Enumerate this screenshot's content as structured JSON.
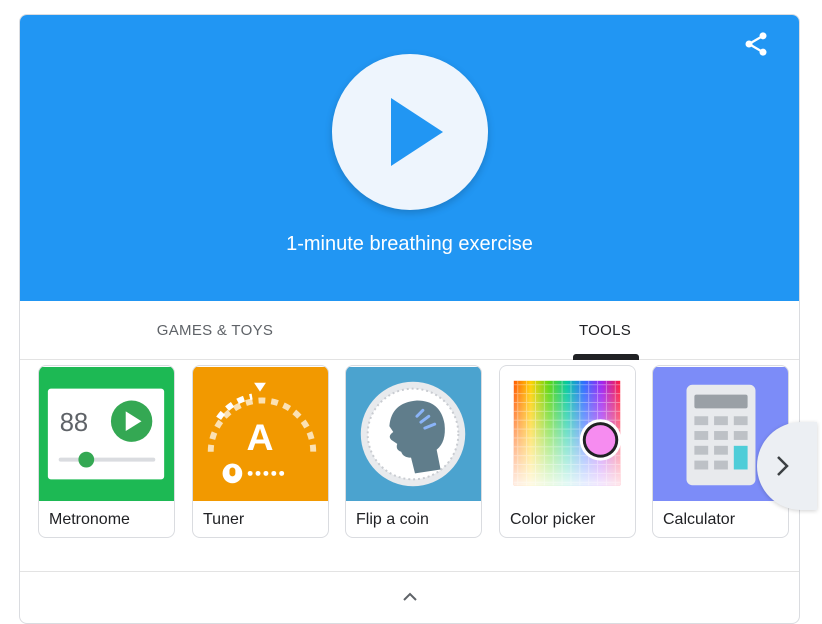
{
  "hero": {
    "title": "1-minute breathing exercise",
    "background_color": "#2196f3",
    "play_icon": "play-icon",
    "share_icon": "share-icon"
  },
  "tabs": [
    {
      "label": "GAMES & TOYS",
      "selected": false
    },
    {
      "label": "TOOLS",
      "selected": true
    }
  ],
  "tools": [
    {
      "label": "Metronome",
      "color": "#1db954",
      "value": "88"
    },
    {
      "label": "Tuner",
      "color": "#f29900",
      "note": "A"
    },
    {
      "label": "Flip a coin",
      "color": "#4ba3cf"
    },
    {
      "label": "Color picker",
      "color": "#ffffff"
    },
    {
      "label": "Calculator",
      "color": "#7c8cf8"
    }
  ],
  "carousel": {
    "next_icon": "chevron-right-icon"
  },
  "footer": {
    "collapse_icon": "chevron-up-icon"
  }
}
